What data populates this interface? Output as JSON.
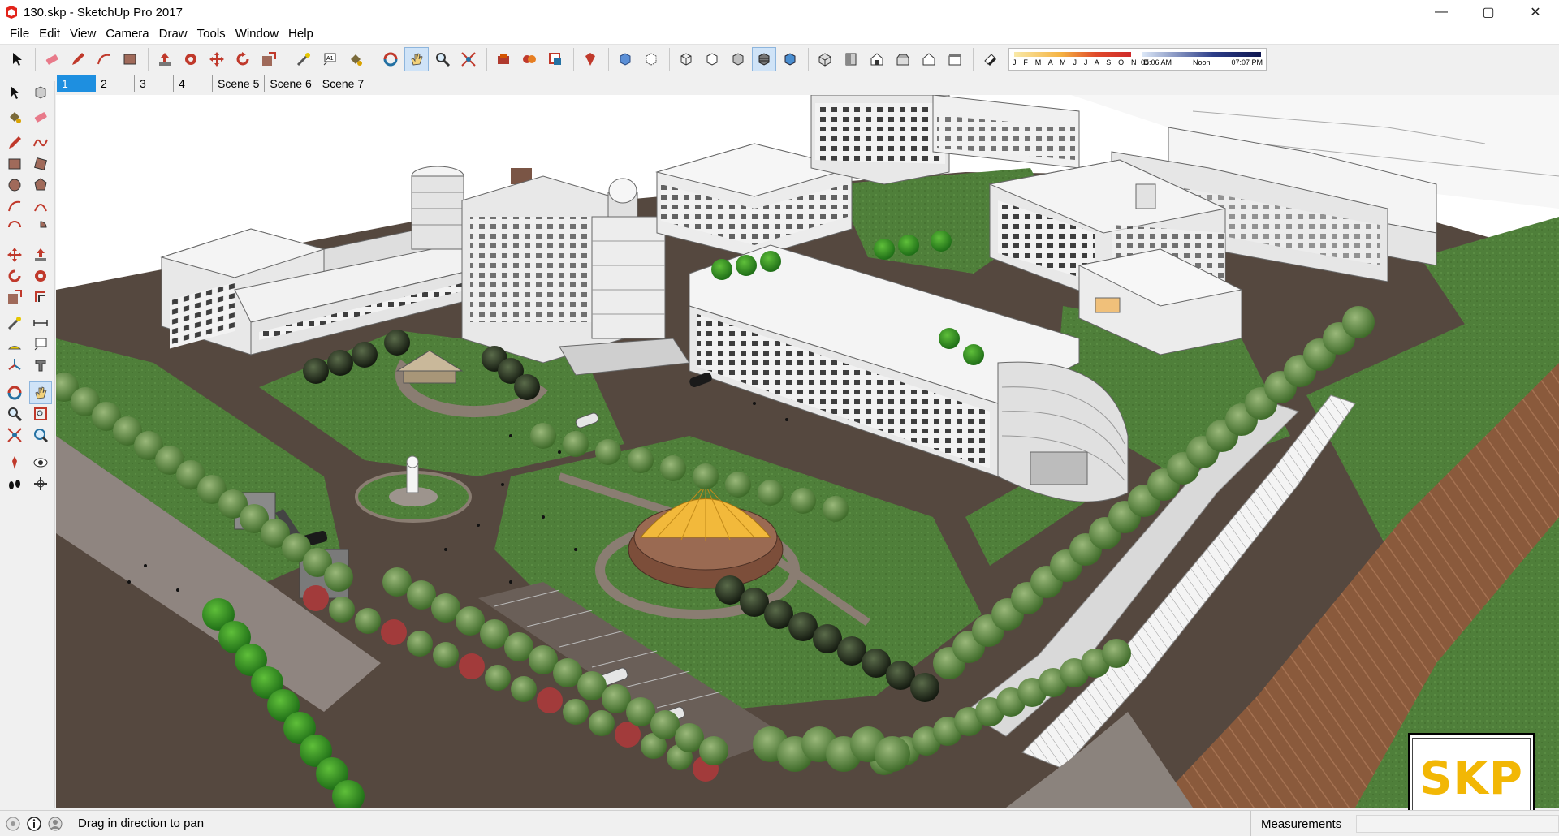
{
  "window": {
    "title": "130.skp - SketchUp Pro 2017",
    "controls": {
      "minimize": "—",
      "maximize": "▢",
      "close": "✕"
    }
  },
  "menu": [
    "File",
    "Edit",
    "View",
    "Camera",
    "Draw",
    "Tools",
    "Window",
    "Help"
  ],
  "toolbar": {
    "icons": [
      "select-icon",
      "eraser-icon",
      "pencil-icon",
      "arc-icon",
      "rectangle-icon",
      "pushpull-icon",
      "followme-icon",
      "move-icon",
      "rotate-icon",
      "scale-icon",
      "tape-icon",
      "text-icon",
      "paint-icon",
      "orbit-icon",
      "pan-icon",
      "zoom-icon",
      "zoom-extents-icon",
      "warehouse-icon",
      "extension-warehouse-icon",
      "layout-icon",
      "ruby-icon",
      "xray-icon",
      "backedges-icon",
      "wireframe-icon",
      "hiddenline-icon",
      "shaded-icon",
      "shaded-textures-icon",
      "monochrome-icon",
      "iso-icon",
      "top-icon",
      "front-icon",
      "right-icon",
      "back-icon",
      "left-icon",
      "shadow-toggle-icon"
    ],
    "active": "pan-icon",
    "shadow_months": "J F M A M J J A S O N D",
    "shadow_time_start": "05:06 AM",
    "shadow_time_mid": "Noon",
    "shadow_time_end": "07:07 PM"
  },
  "scenes": {
    "tabs": [
      "1",
      "2",
      "3",
      "4",
      "Scene 5",
      "Scene 6",
      "Scene 7"
    ],
    "active_index": 0
  },
  "left_tools": [
    [
      "select-icon",
      "component-icon"
    ],
    [
      "paint-bucket-icon",
      "eraser-icon"
    ],
    [
      "line-icon",
      "freehand-icon"
    ],
    [
      "rectangle-icon",
      "rotated-rectangle-icon"
    ],
    [
      "circle-icon",
      "polygon-icon"
    ],
    [
      "arc-icon",
      "two-point-arc-icon"
    ],
    [
      "three-point-arc-icon",
      "pie-icon"
    ],
    [
      "move-icon",
      "pushpull-icon"
    ],
    [
      "rotate-icon",
      "followme-icon"
    ],
    [
      "scale-icon",
      "offset-icon"
    ],
    [
      "tape-measure-icon",
      "dimension-icon"
    ],
    [
      "protractor-icon",
      "text-icon"
    ],
    [
      "axes-icon",
      "3d-text-icon"
    ],
    [
      "orbit-icon",
      "pan-icon"
    ],
    [
      "zoom-icon",
      "zoom-window-icon"
    ],
    [
      "zoom-extents-icon",
      "previous-view-icon"
    ],
    [
      "position-camera-icon",
      "look-around-icon"
    ],
    [
      "walk-icon",
      "section-plane-icon"
    ]
  ],
  "status": {
    "hint": "Drag in direction to pan",
    "measurements_label": "Measurements",
    "measurements_value": ""
  },
  "watermark": {
    "text": "SKP"
  },
  "colors": {
    "accent": "#1e8fe0",
    "ground": "#55483f",
    "grass": "#4f7f3a",
    "building": "#eeeeee",
    "canopy": "#f2b93b",
    "track": "#8a5a3c",
    "logo_text": "#f2b705",
    "logo_bar": "#5a1a82"
  }
}
